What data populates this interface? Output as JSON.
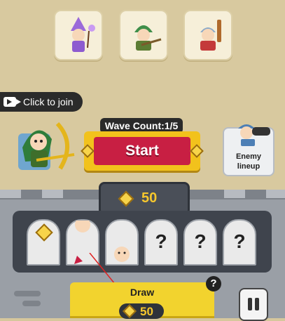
{
  "heroes": [
    {
      "name": "wizard"
    },
    {
      "name": "archer"
    },
    {
      "name": "warrior"
    }
  ],
  "join": {
    "label": "Click to join"
  },
  "wave": {
    "label": "Wave Count:1/5"
  },
  "start": {
    "label": "Start"
  },
  "enemy": {
    "line1": "Enemy",
    "line2": "lineup"
  },
  "gold": {
    "amount": "50"
  },
  "slots": [
    "gem",
    "face",
    "face",
    "?",
    "?",
    "?"
  ],
  "draw": {
    "label": "Draw",
    "cost": "50"
  },
  "help": {
    "label": "?"
  },
  "colors": {
    "gold": "#f6c72d",
    "start_red": "#c81f43",
    "button_yellow": "#f2d32e"
  }
}
